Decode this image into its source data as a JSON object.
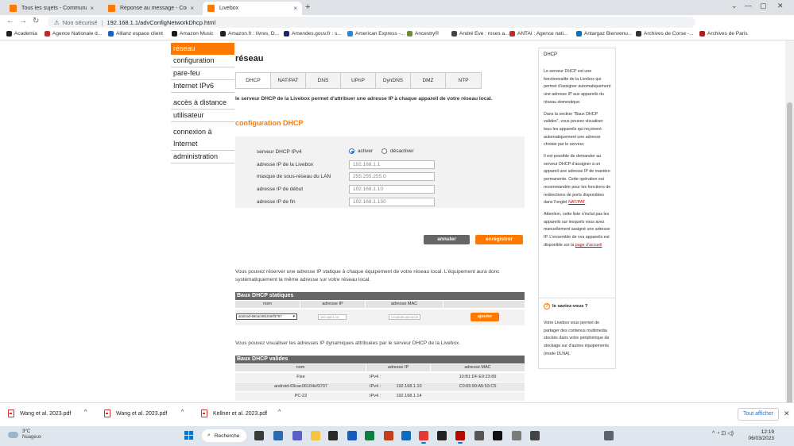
{
  "browser": {
    "tabs": [
      {
        "title": "Tous les sujets - Communauté Or",
        "close": "×"
      },
      {
        "title": "Réponse au message - Commun",
        "close": "×"
      },
      {
        "title": "Livebox",
        "close": "×"
      }
    ],
    "new_tab": "+",
    "window_controls": [
      "⌄",
      "—",
      "▢",
      "✕"
    ],
    "nav": {
      "back": "←",
      "forward": "→",
      "reload": "↻"
    },
    "address": {
      "warning": "⚠",
      "security_label": "Non sécurisé",
      "separator": "|",
      "url": "192.168.1.1/advConfigNetworkDhcp.html"
    },
    "bookmarks": [
      {
        "label": "Academia",
        "color": "#222222"
      },
      {
        "label": "Agence Nationale d...",
        "color": "#c62828"
      },
      {
        "label": "Allianz espace client",
        "color": "#1565c0"
      },
      {
        "label": "Amazon Music",
        "color": "#1a1a1a"
      },
      {
        "label": "Amazon.fr : livres, D...",
        "color": "#222222"
      },
      {
        "label": "Amendes.gouv.fr : s...",
        "color": "#1a237e"
      },
      {
        "label": "American Express -...",
        "color": "#1e88e5"
      },
      {
        "label": "Ancestry®",
        "color": "#6d8b3a"
      },
      {
        "label": "André Eve : roses a...",
        "color": "#444444"
      },
      {
        "label": "ANTAI : Agence nati...",
        "color": "#c62828"
      },
      {
        "label": "Antargaz Bienvenu...",
        "color": "#0277bd"
      },
      {
        "label": "Archives de Corse -...",
        "color": "#333333"
      },
      {
        "label": "Archives de Paris",
        "color": "#b71c1c"
      }
    ]
  },
  "left_nav": {
    "items": [
      {
        "label": "réseau",
        "selected": true
      },
      {
        "label": "configuration",
        "selected": false
      },
      {
        "label": "pare-feu",
        "selected": false
      },
      {
        "label": "Internet IPv6",
        "selected": false
      },
      {
        "label": "accès à distance",
        "selected": false
      },
      {
        "label": "utilisateur",
        "selected": false
      },
      {
        "label": "connexion à",
        "selected": false
      },
      {
        "label": "Internet",
        "selected": false
      },
      {
        "label": "administration",
        "selected": false
      }
    ]
  },
  "main": {
    "title": "réseau",
    "tabs": [
      "DHCP",
      "NAT/PAT",
      "DNS",
      "UPnP",
      "DynDNS",
      "DMZ",
      "NTP"
    ],
    "active_tab": "DHCP",
    "intro": "le serveur DHCP de la Livebox permet d'attribuer une adresse IP à chaque appareil de votre réseau local.",
    "config_title": "configuration DHCP",
    "form": {
      "server_label": "serveur DHCP IPv4",
      "enable_label": "activer",
      "disable_label": "désactiver",
      "enabled": true,
      "fields": [
        {
          "label": "adresse IP de la Livebox",
          "value": "192.168.1.1"
        },
        {
          "label": "masque de sous-réseau du LAN",
          "value": "255.255.255.0"
        },
        {
          "label": "adresse IP de début",
          "value": "192.168.1.10"
        },
        {
          "label": "adresse IP de fin",
          "value": "192.168.1.150"
        }
      ]
    },
    "cancel_label": "annuler",
    "save_label": "enregistrer",
    "static_intro": "Vous pouvez réserver une adresse IP statique à chaque équipement de votre réseau local. L'équipement aura donc systématiquement la même adresse sur votre réseau local.",
    "static_table": {
      "title": "Baux DHCP statiques",
      "headers": [
        "nom",
        "adresse IP",
        "adresse MAC"
      ],
      "select_value": "android-69cac06104ef3707",
      "ip_placeholder": "192.168.1.10",
      "mac_value": "C0:65:99:A5:53:C5",
      "add_label": "ajouter"
    },
    "dynamic_intro": "Vous pouvez visualiser les adresses IP dynamiques attribuées par le serveur DHCP de la Livebox.",
    "dynamic_table": {
      "title": "Baux DHCP valides",
      "headers": [
        "nom",
        "adresse IP",
        "adresse MAC"
      ],
      "rows": [
        {
          "name": "Fixe",
          "proto": "IPv4 :",
          "ip": "",
          "mac": "10:B1:DF:E9:23:89"
        },
        {
          "name": "android-69cac06104ef3707",
          "proto": "IPv4 :",
          "ip": "192.168.1.10",
          "mac": "C0:65:99:A5:53:C5"
        },
        {
          "name": "PC-22",
          "proto": "IPv4 :",
          "ip": "192.168.1.14",
          "mac": ""
        }
      ]
    }
  },
  "sidebar": {
    "title": "DHCP",
    "paragraphs": [
      "Le serveur DHCP est une fonctionnalité de la Livebox qui permet d'assigner automatiquement une adresse IP aux appareils du réseau domestique.",
      "Dans la section \"Baux DHCP valides\", vous pouvez visualiser tous les appareils qui reçoivent automatiquement une adresse choisie par le serveur.",
      "Il est possible de demander au serveur DHCP d'assigner à un appareil une adresse IP de manière permanente. Cette opération est recommandée pour les fonctions de redirections de ports disponibles dans l'onglet",
      "Attention, cette liste n'inclut pas les appareils sur lesquels vous avez manuellement assigné une adresse IP. L'ensemble de vos appareils est disponible sur la"
    ],
    "link1": "NAT/PAT",
    "link2": "page d'accueil",
    "tip_title": "le saviez-vous ?",
    "tip_q": "?",
    "tip_text": "Votre Livebox vous permet de partager des contenus multimedia stockés dans votre périphérique de stockage sur d'autres équipements (mode DLNA)."
  },
  "downloads": {
    "files": [
      "Wang et al. 2023.pdf",
      "Wang et al. 2023.pdf",
      "Kellner et al. 2023.pdf"
    ],
    "chevron": "^",
    "show_all": "Tout afficher",
    "close": "✕"
  },
  "taskbar": {
    "temp": "3°C",
    "weather": "Nuageux",
    "search_label": "Recherche",
    "search_icon": "⌕",
    "time": "12:19",
    "date": "06/03/2023",
    "tray": "^ ◔ ⊡ ◁)",
    "icons": [
      {
        "name": "task-view-icon",
        "color": "#3a3a3a"
      },
      {
        "name": "widgets-icon",
        "color": "#2b6cb0"
      },
      {
        "name": "teams-icon",
        "color": "#5b5fc7"
      },
      {
        "name": "file-explorer-icon",
        "color": "#f6c343"
      },
      {
        "name": "dell-icon",
        "color": "#2a2a2a"
      },
      {
        "name": "word-icon",
        "color": "#185abd"
      },
      {
        "name": "excel-icon",
        "color": "#107c41"
      },
      {
        "name": "powerpoint-icon",
        "color": "#c43e1c"
      },
      {
        "name": "outlook-icon",
        "color": "#0f6cbd"
      },
      {
        "name": "chrome-icon",
        "color": "#e53935"
      },
      {
        "name": "app-icon-1",
        "color": "#222222"
      },
      {
        "name": "acrobat-icon",
        "color": "#b30b00"
      },
      {
        "name": "app-icon-2",
        "color": "#555555"
      },
      {
        "name": "media-player-icon",
        "color": "#111111"
      },
      {
        "name": "app-icon-3",
        "color": "#7b7b7b"
      },
      {
        "name": "app-icon-4",
        "color": "#444444"
      },
      {
        "name": "settings-icon",
        "color": "#5a6470"
      }
    ]
  }
}
